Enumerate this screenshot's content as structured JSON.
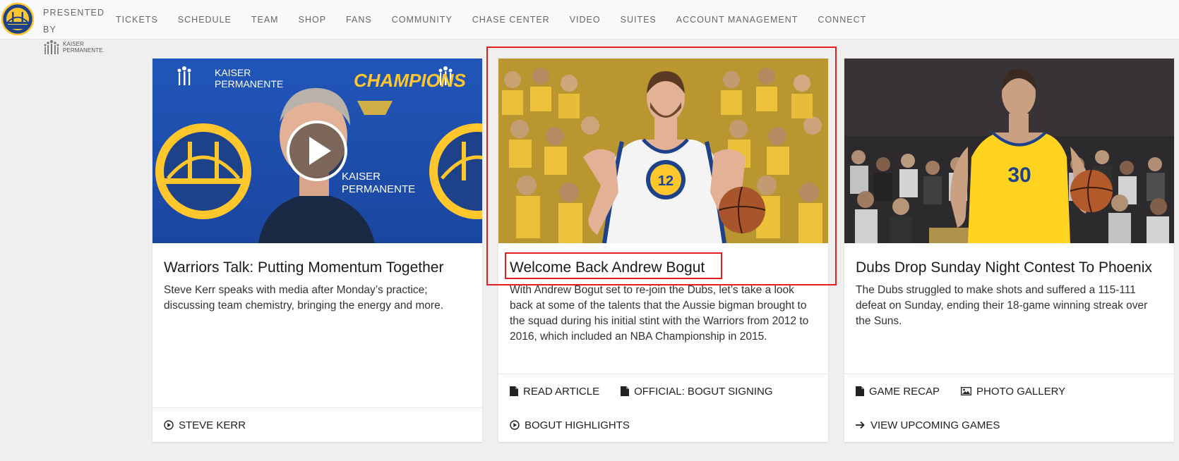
{
  "header": {
    "presented_by": "PRESENTED BY",
    "sponsor_line1": "KAISER",
    "sponsor_line2": "PERMANENTE.",
    "nav": [
      "TICKETS",
      "SCHEDULE",
      "TEAM",
      "SHOP",
      "FANS",
      "COMMUNITY",
      "CHASE CENTER",
      "VIDEO",
      "SUITES",
      "ACCOUNT MANAGEMENT",
      "CONNECT"
    ]
  },
  "cards": [
    {
      "title": "Warriors Talk: Putting Momentum Together",
      "description": "Steve Kerr speaks with media after Monday’s practice; discussing team chemistry, bringing the energy and more.",
      "backdrop_text_1": "KAISER",
      "backdrop_text_2": "PERMANENTE",
      "backdrop_champ": "CHAMPIONS",
      "links": [
        {
          "icon": "play-circle-icon",
          "label": "STEVE KERR"
        }
      ]
    },
    {
      "title": "Welcome Back Andrew Bogut",
      "description": "With Andrew Bogut set to re-join the Dubs, let’s take a look back at some of the talents that the Aussie bigman brought to the squad during his initial stint with the Warriors from 2012 to 2016, which included an NBA Championship in 2015.",
      "jersey_number": "12",
      "links": [
        {
          "icon": "document-icon",
          "label": "READ ARTICLE"
        },
        {
          "icon": "document-icon",
          "label": "OFFICIAL: BOGUT SIGNING"
        },
        {
          "icon": "play-circle-icon",
          "label": "BOGUT HIGHLIGHTS"
        }
      ]
    },
    {
      "title": "Dubs Drop Sunday Night Contest To Phoenix",
      "description": "The Dubs struggled to make shots and suffered a 115-111 defeat on Sunday, ending their 18-game winning streak over the Suns.",
      "jersey_number": "30",
      "links": [
        {
          "icon": "document-icon",
          "label": "GAME RECAP"
        },
        {
          "icon": "image-icon",
          "label": "PHOTO GALLERY"
        },
        {
          "icon": "arrow-right-icon",
          "label": "VIEW UPCOMING GAMES"
        }
      ]
    }
  ],
  "colors": {
    "warriors_blue": "#1d428a",
    "warriors_gold": "#ffc72c",
    "highlight_red": "#e02020"
  }
}
